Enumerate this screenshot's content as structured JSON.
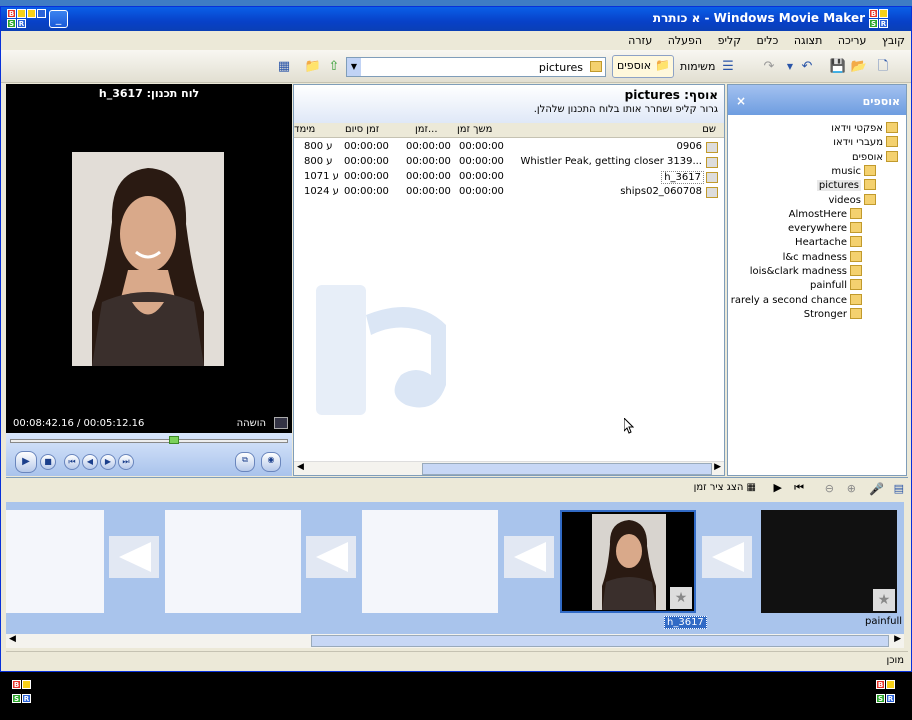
{
  "app": {
    "title": "Windows Movie Maker - א כותרת"
  },
  "menu": [
    "קובץ",
    "עריכה",
    "תצוגה",
    "כלים",
    "קליפ",
    "הפעלה",
    "עזרה"
  ],
  "toolbar": {
    "tasks_label": "משימות",
    "collections_label": "אוספים",
    "path_value": "pictures"
  },
  "preview": {
    "title": "לוח תכנון: h_3617",
    "time": "00:08:42.16 / 00:05:12.16",
    "pause_label": "הושהה"
  },
  "content": {
    "title": "אוסף: pictures",
    "subtitle": "גרור קליפ ושחרר אותו בלוח התכנון שלהלן.",
    "columns": [
      "שם",
      "משך זמן",
      "זמן...",
      "זמן סיום",
      "מימד"
    ],
    "rows": [
      {
        "name": "0906",
        "duration": "00:00:00",
        "start": "00:00:00",
        "end": "00:00:00",
        "dim": "800 ע"
      },
      {
        "name": "Whistler Peak, getting closer 3139...",
        "duration": "00:00:00",
        "start": "00:00:00",
        "end": "00:00:00",
        "dim": "800 ע"
      },
      {
        "name": "h_3617",
        "duration": "00:00:00",
        "start": "00:00:00",
        "end": "00:00:00",
        "dim": "1071 ע"
      },
      {
        "name": "ships02_060708",
        "duration": "00:00:00",
        "start": "00:00:00",
        "end": "00:00:00",
        "dim": "1024 ע"
      }
    ]
  },
  "tree": {
    "title": "אוספים",
    "items": [
      {
        "label": "אפקטי וידאו",
        "level": 0
      },
      {
        "label": "מעברי וידאו",
        "level": 0
      },
      {
        "label": "אוספים",
        "level": 0
      },
      {
        "label": "music",
        "level": 1
      },
      {
        "label": "pictures",
        "level": 1,
        "selected": true
      },
      {
        "label": "videos",
        "level": 1
      },
      {
        "label": "AlmostHere",
        "level": 2
      },
      {
        "label": "everywhere",
        "level": 2
      },
      {
        "label": "Heartache",
        "level": 2
      },
      {
        "label": "l&c madness",
        "level": 2
      },
      {
        "label": "lois&clark madness",
        "level": 2
      },
      {
        "label": "painfull",
        "level": 2
      },
      {
        "label": "rarely a second chance",
        "level": 2
      },
      {
        "label": "Stronger",
        "level": 2
      }
    ]
  },
  "storyboard": {
    "timeline_label": "הצג ציר זמן",
    "clips": [
      {
        "label": "painfull"
      },
      {
        "label": "h_3617"
      }
    ]
  },
  "status": {
    "text": "מוכן"
  },
  "colors": {
    "titlebar": "#0a4fd8",
    "selection": "#316ac5",
    "storyboard_bg": "#a9c4ec"
  }
}
